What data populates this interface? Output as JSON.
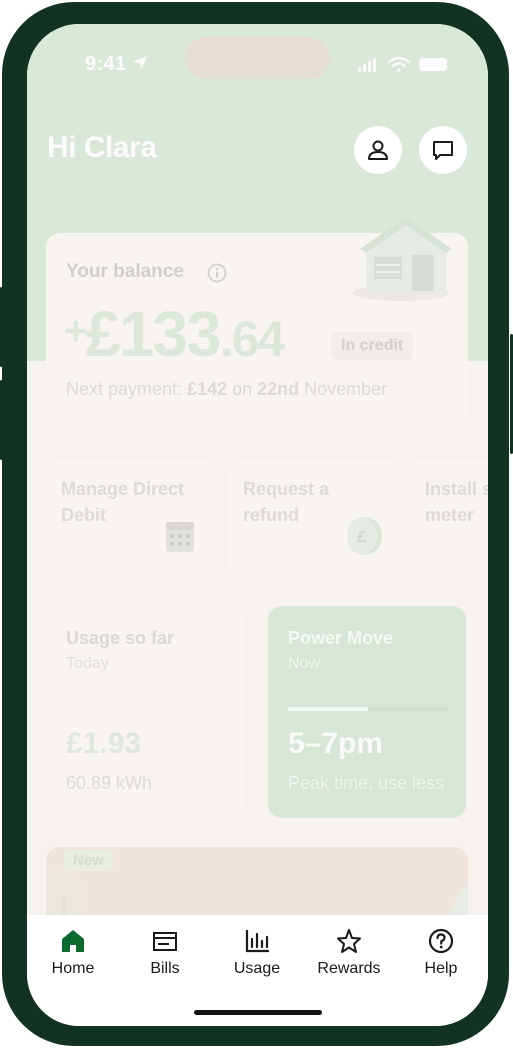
{
  "status": {
    "time": "9:41"
  },
  "header": {
    "greeting": "Hi Clara"
  },
  "balance": {
    "label": "Your balance",
    "sign": "+",
    "pounds": "£133",
    "pence": ".64",
    "status": "In credit",
    "next_payment_prefix": "Next payment: ",
    "next_payment_amount": "£142",
    "next_payment_on": " on ",
    "next_payment_date": "22nd",
    "next_payment_month": " November"
  },
  "actions": [
    {
      "label": "Manage Direct Debit"
    },
    {
      "label": "Request a refund"
    },
    {
      "label": "Install smart meter"
    }
  ],
  "usage": {
    "title": "Usage so far",
    "period": "Today",
    "cost": "£1.93",
    "energy": "60.89 kWh"
  },
  "power_move": {
    "title": "Power Move",
    "period": "Now",
    "window": "5–7pm",
    "note": "Peak time, use less",
    "progress": 0.5
  },
  "promo": {
    "badge": "New"
  },
  "tabs": [
    {
      "label": "Home",
      "icon": "home-icon",
      "active": true
    },
    {
      "label": "Bills",
      "icon": "bills-icon"
    },
    {
      "label": "Usage",
      "icon": "usage-chart-icon"
    },
    {
      "label": "Rewards",
      "icon": "star-icon"
    },
    {
      "label": "Help",
      "icon": "help-icon"
    }
  ],
  "colors": {
    "frame": "#123322",
    "accent": "#0b6b2e",
    "hero": "#d9e8d9",
    "card_green": "#d7e6d6"
  }
}
